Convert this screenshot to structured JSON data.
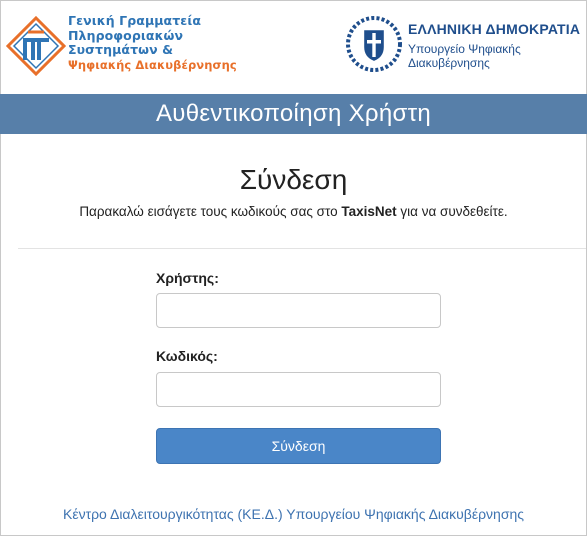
{
  "header": {
    "gsis": {
      "line1": "Γενική Γραμματεία",
      "line2": "Πληροφοριακών",
      "line3": "Συστημάτων &",
      "line4": "Ψηφιακής Διακυβέρνησης",
      "icon": "gsis-logo-icon",
      "colors": {
        "blue": "#2f75b5",
        "orange": "#e8702a"
      }
    },
    "republic": {
      "title": "ΕΛΛΗΝΙΚΗ ΔΗΜΟΚΡΑΤΙΑ",
      "ministry_line1": "Υπουργείο Ψηφιακής",
      "ministry_line2": "Διακυβέρνησης",
      "icon": "greek-emblem-icon",
      "color": "#1f4e8c"
    }
  },
  "banner": {
    "title": "Αυθεντικοποίηση Χρήστη",
    "color": "#577fa9"
  },
  "login": {
    "heading": "Σύνδεση",
    "instruction_before": "Παρακαλώ εισάγετε τους κωδικούς σας στο ",
    "instruction_bold": "TaxisNet",
    "instruction_after": " για να συνδεθείτε.",
    "username_label": "Χρήστης:",
    "username_value": "",
    "password_label": "Κωδικός:",
    "password_value": "",
    "submit_label": "Σύνδεση",
    "button_color": "#4a86c8"
  },
  "footer": {
    "link_text": "Κέντρο Διαλειτουργικότητας (ΚΕ.Δ.) Υπουργείου Ψηφιακής Διακυβέρνησης",
    "link_color": "#3e73b0"
  }
}
